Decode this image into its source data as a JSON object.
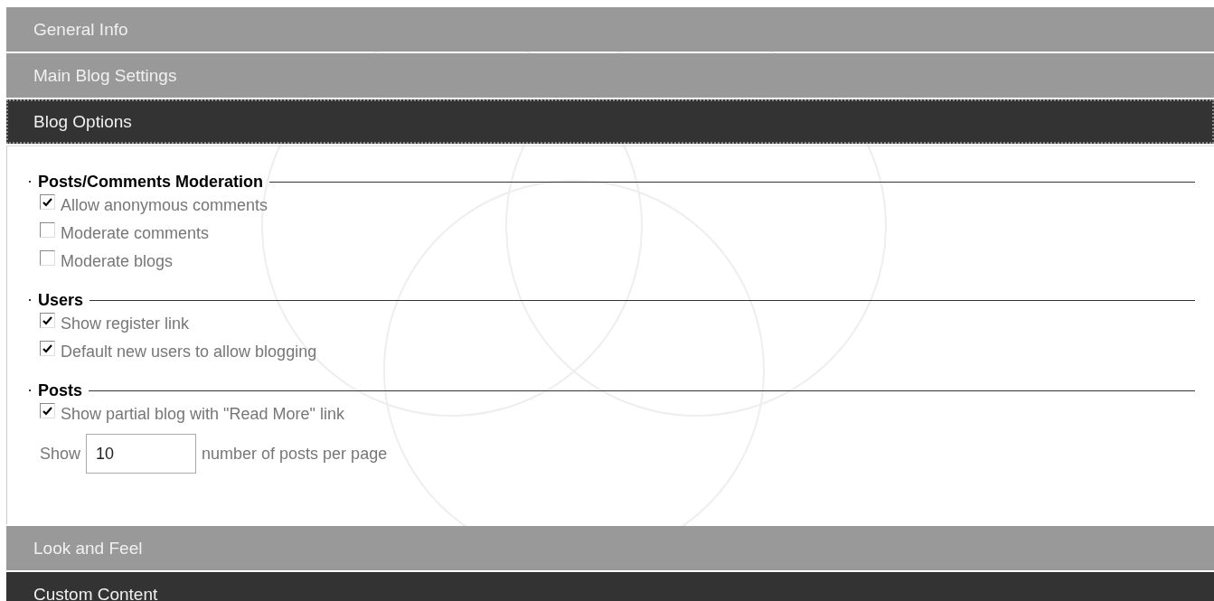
{
  "sections_before": [
    {
      "title": "General Info",
      "active": false,
      "focused": false
    },
    {
      "title": "Main Blog Settings",
      "active": false,
      "focused": false
    },
    {
      "title": "Blog Options",
      "active": true,
      "focused": true
    }
  ],
  "panel": {
    "groups": [
      {
        "legend": "Posts/Comments Moderation",
        "items": [
          {
            "kind": "checkbox",
            "label": "Allow anonymous comments",
            "checked": true
          },
          {
            "kind": "checkbox",
            "label": "Moderate comments",
            "checked": false
          },
          {
            "kind": "checkbox",
            "label": "Moderate blogs",
            "checked": false
          }
        ]
      },
      {
        "legend": "Users",
        "items": [
          {
            "kind": "checkbox",
            "label": "Show register link",
            "checked": true
          },
          {
            "kind": "checkbox",
            "label": "Default new users to allow blogging",
            "checked": true
          }
        ]
      },
      {
        "legend": "Posts",
        "items": [
          {
            "kind": "checkbox",
            "label": "Show partial blog with \"Read More\" link",
            "checked": true
          },
          {
            "kind": "number",
            "before": "Show",
            "value": "10",
            "after": "number of posts per page"
          }
        ]
      }
    ]
  },
  "sections_after": [
    {
      "title": "Look and Feel",
      "active": false,
      "focused": false
    },
    {
      "title": "Custom Content",
      "active": true,
      "focused": false
    }
  ]
}
